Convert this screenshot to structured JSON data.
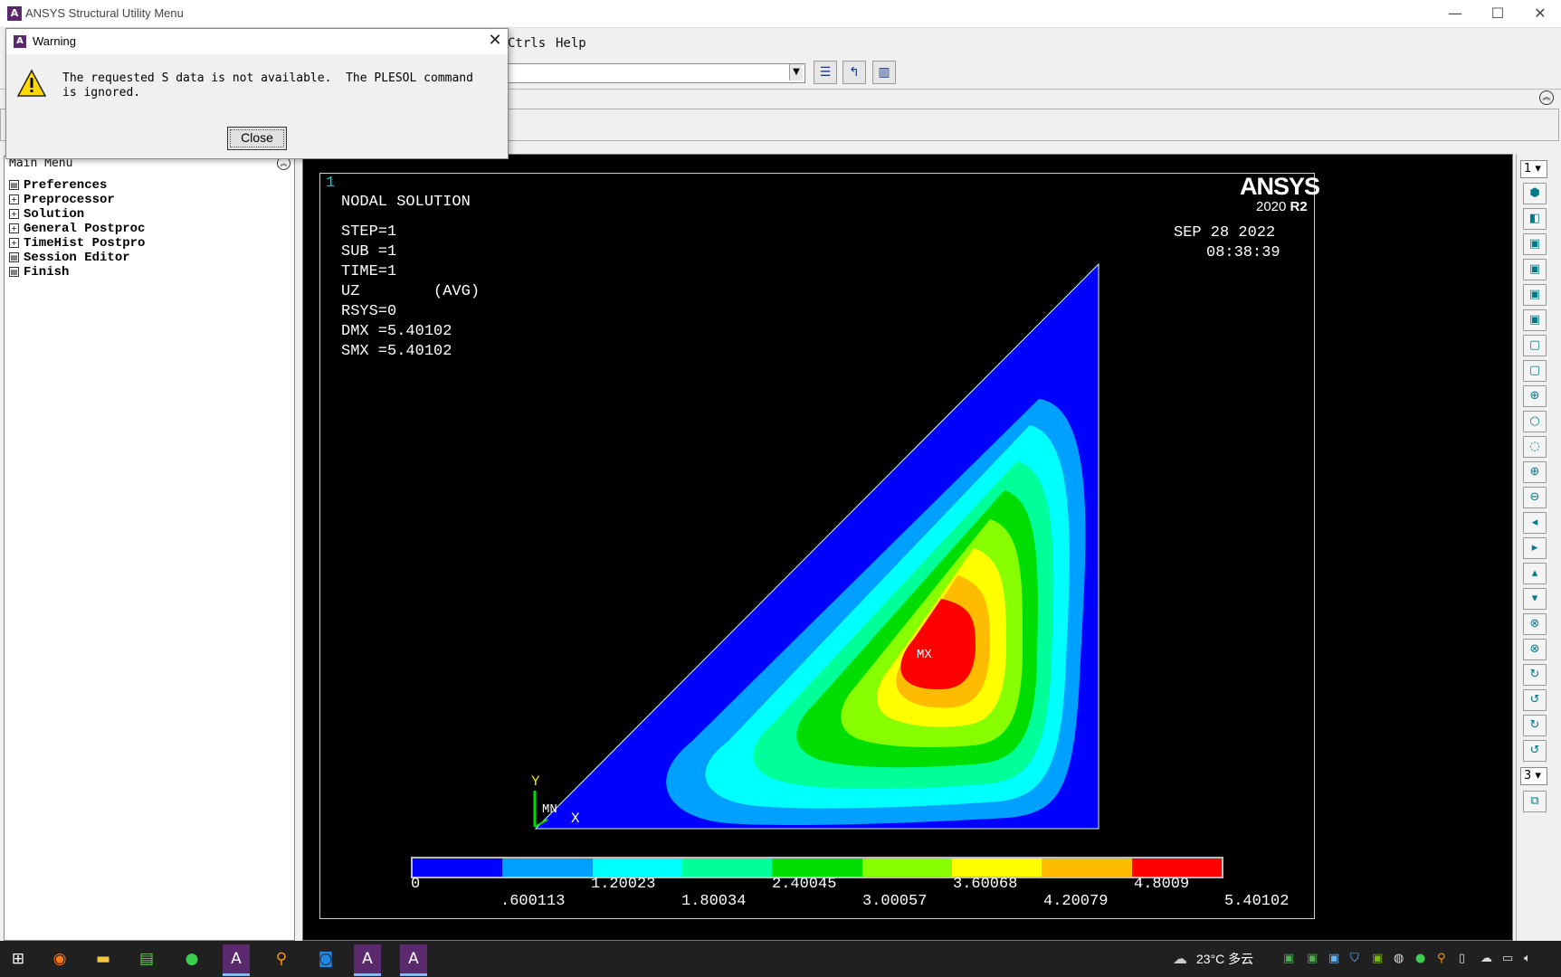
{
  "window": {
    "title": "ANSYS Structural Utility Menu",
    "minimize": "—",
    "maximize": "☐",
    "close": "✕"
  },
  "menubar": {
    "visible_items": [
      "Ctrls",
      "Help"
    ]
  },
  "toolbar": {
    "command_input": "",
    "buttons": [
      "save-db-icon",
      "resume-db-icon",
      "powergraphics-icon"
    ]
  },
  "main_menu": {
    "title": "Main Menu",
    "items": [
      {
        "label": "Preferences",
        "icon": "grid"
      },
      {
        "label": "Preprocessor",
        "icon": "plus"
      },
      {
        "label": "Solution",
        "icon": "plus"
      },
      {
        "label": "General Postproc",
        "icon": "plus"
      },
      {
        "label": "TimeHist Postpro",
        "icon": "plus"
      },
      {
        "label": "Session Editor",
        "icon": "grid"
      },
      {
        "label": "Finish",
        "icon": "grid"
      }
    ]
  },
  "graphics": {
    "window_number": "1",
    "heading": "NODAL SOLUTION",
    "info_lines": [
      "STEP=1",
      "SUB =1",
      "TIME=1",
      "UZ        (AVG)",
      "RSYS=0",
      "DMX =5.40102",
      "SMX =5.40102"
    ],
    "logo": "ANSYS",
    "version_prefix": "2020",
    "version_suffix": "R2",
    "date": "SEP 28 2022",
    "time": "08:38:39",
    "mx_label": "MX",
    "mn_label": "MN",
    "axis_x": "X",
    "axis_y": "Y",
    "legend_colors": [
      "#0000ff",
      "#00a0ff",
      "#00ffff",
      "#00ff99",
      "#00dd00",
      "#88ff00",
      "#ffff00",
      "#ffbb00",
      "#ff0000"
    ],
    "legend_top_labels": [
      "0",
      "1.20023",
      "2.40045",
      "3.60068",
      "4.8009"
    ],
    "legend_bottom_labels": [
      ".600113",
      "1.80034",
      "3.00057",
      "4.20079",
      "5.40102"
    ]
  },
  "right_toolbar": {
    "window_combo": "1",
    "rotate_combo": "3"
  },
  "dialog": {
    "title": "Warning",
    "message": "The requested S data is not available.  The PLESOL command\nis ignored.",
    "close_button": "Close"
  },
  "taskbar": {
    "weather": "23°C 多云"
  }
}
